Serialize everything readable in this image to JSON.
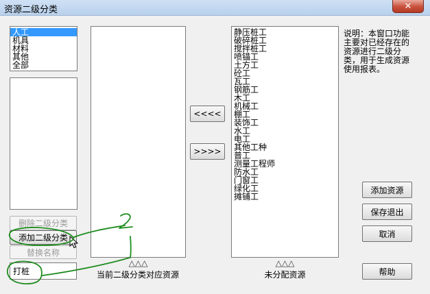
{
  "window": {
    "title": "资源二级分类",
    "close_glyph": "✕"
  },
  "categories": [
    "人工",
    "机具",
    "材料",
    "其他",
    "全部"
  ],
  "selected_category_index": 0,
  "sub_category_list": [],
  "buttons": {
    "delete_sub": "删除二级分类",
    "add_sub": "添加二级分类",
    "rename": "替换名称",
    "move_left": "<<<<",
    "move_right": ">>>>",
    "add_resource": "添加资源",
    "save_exit": "保存退出",
    "cancel": "取消",
    "help": "帮助"
  },
  "name_input": {
    "value": "打桩"
  },
  "current_resources": {
    "items": [],
    "arrows": "△△△",
    "caption": "当前二级分类对应资源"
  },
  "unassigned_resources": {
    "items": [
      "静压桩工",
      "破碎桩工",
      "搅拌桩工",
      "喷锚工",
      "土方工",
      "砼工",
      "瓦工",
      "钢筋工",
      "木工",
      "机械工",
      "棚工",
      "装饰工",
      "水工",
      "电工",
      "其他工种",
      "普工",
      "测量工程师",
      "防水工",
      "门窗工",
      "绿化工",
      "摊铺工"
    ],
    "arrows": "△△△",
    "caption": "未分配资源"
  },
  "description": "说明：本窗口功能主要对已经存在的资源进行二级分类，用于生成资源使用报表。",
  "colors": {
    "annotation_green": "#1e8c1e",
    "selection_blue": "#3399ff"
  }
}
